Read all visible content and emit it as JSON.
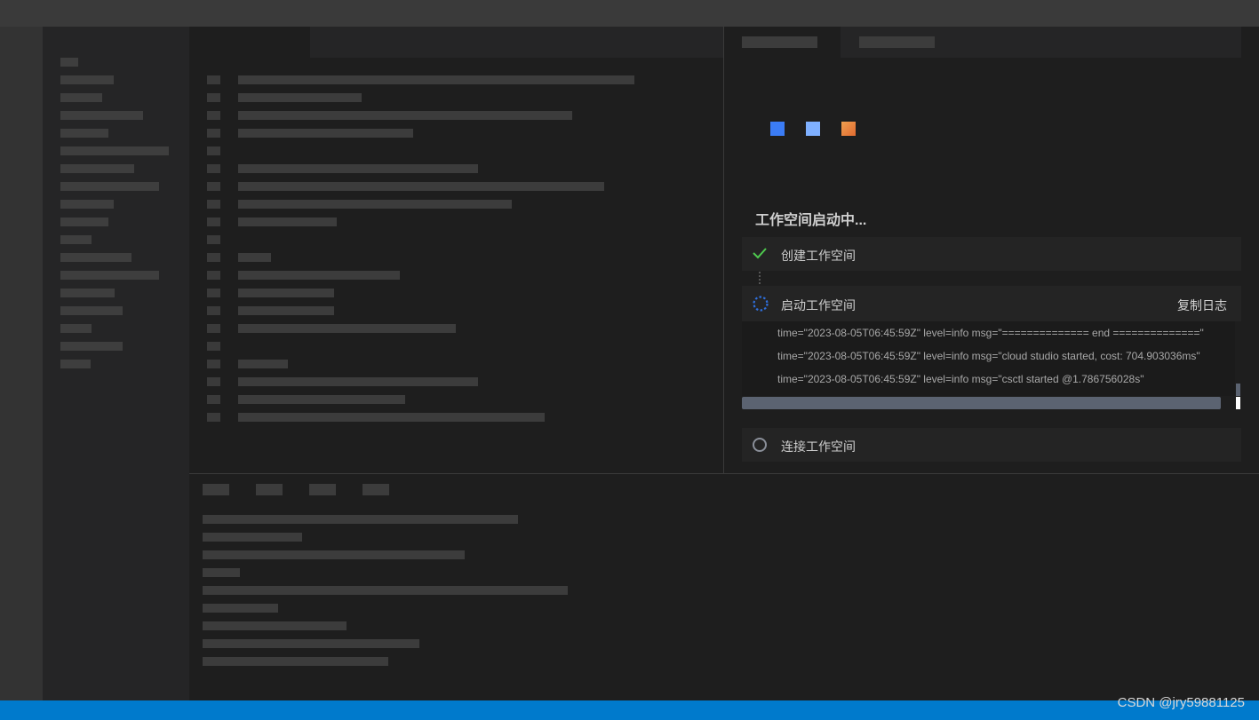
{
  "workspace": {
    "title": "工作空间启动中...",
    "steps": [
      {
        "label": "创建工作空间",
        "status": "done"
      },
      {
        "label": "启动工作空间",
        "status": "loading",
        "action_label": "复制日志"
      },
      {
        "label": "连接工作空间",
        "status": "pending"
      }
    ],
    "logs": [
      "time=\"2023-08-05T06:45:59Z\" level=info msg=\"============== end ==============\"",
      "time=\"2023-08-05T06:45:59Z\" level=info msg=\"cloud studio started, cost: 704.903036ms\"",
      "time=\"2023-08-05T06:45:59Z\" level=info msg=\"csctl started @1.786756028s\""
    ]
  },
  "watermark": "CSDN @jry59881125",
  "colors": {
    "accent_status_bar": "#007acc",
    "check_green": "#4ec94e",
    "spinner_blue": "#2f6fdc",
    "logo_blue": "#3b7cf5",
    "logo_light_blue": "#7fb0ff",
    "logo_orange": "#f0883a"
  },
  "icons": [
    "check-icon",
    "spinner-icon",
    "circle-icon"
  ]
}
